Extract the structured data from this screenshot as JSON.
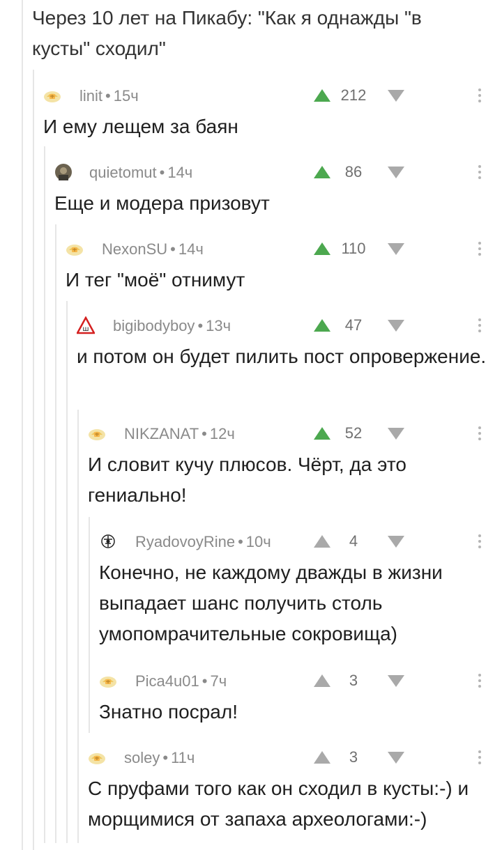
{
  "top_comment": {
    "text": "Через 10 лет на Пикабу: \"Как я однажды \"в кусты\" сходил\""
  },
  "colors": {
    "upvote_active": "#4ca84f",
    "upvote_inactive": "#a9a9a9",
    "downvote": "#a9a9a9",
    "thread_line": "#e6e6e6"
  },
  "comments": [
    {
      "author": "linit",
      "time": "15ч",
      "rating": "212",
      "upvoted": true,
      "avatar": "default-avatar-icon",
      "text": "И ему лещем за баян"
    },
    {
      "author": "quietomut",
      "time": "14ч",
      "rating": "86",
      "upvoted": true,
      "avatar": "photo-avatar-icon",
      "text": "Еще и модера призовут"
    },
    {
      "author": "NexonSU",
      "time": "14ч",
      "rating": "110",
      "upvoted": true,
      "avatar": "default-avatar-icon",
      "text": "И тег \"моё\" отнимут"
    },
    {
      "author": "bigibodyboy",
      "time": "13ч",
      "rating": "47",
      "upvoted": true,
      "avatar": "warning-sign-avatar-icon",
      "text": "и потом он будет пилить пост опровержение."
    },
    {
      "author": "NIKZANAT",
      "time": "12ч",
      "rating": "52",
      "upvoted": true,
      "avatar": "default-avatar-icon",
      "text": "И словит кучу плюсов. Чёрт, да это гениально!"
    },
    {
      "author": "RyadovoyRine",
      "time": "10ч",
      "rating": "4",
      "upvoted": false,
      "avatar": "emblem-avatar-icon",
      "text": "Конечно, не каждому дважды в жизни выпадает шанс получить столь умопомрачительные сокровища)"
    },
    {
      "author": "Pica4u01",
      "time": "7ч",
      "rating": "3",
      "upvoted": false,
      "avatar": "default-avatar-icon",
      "text": "Знатно посрал!"
    },
    {
      "author": "soley",
      "time": "11ч",
      "rating": "3",
      "upvoted": false,
      "avatar": "default-avatar-icon",
      "text": "С пруфами того как он сходил в кусты:-) и морщимися от запаха археологами:-)"
    }
  ]
}
